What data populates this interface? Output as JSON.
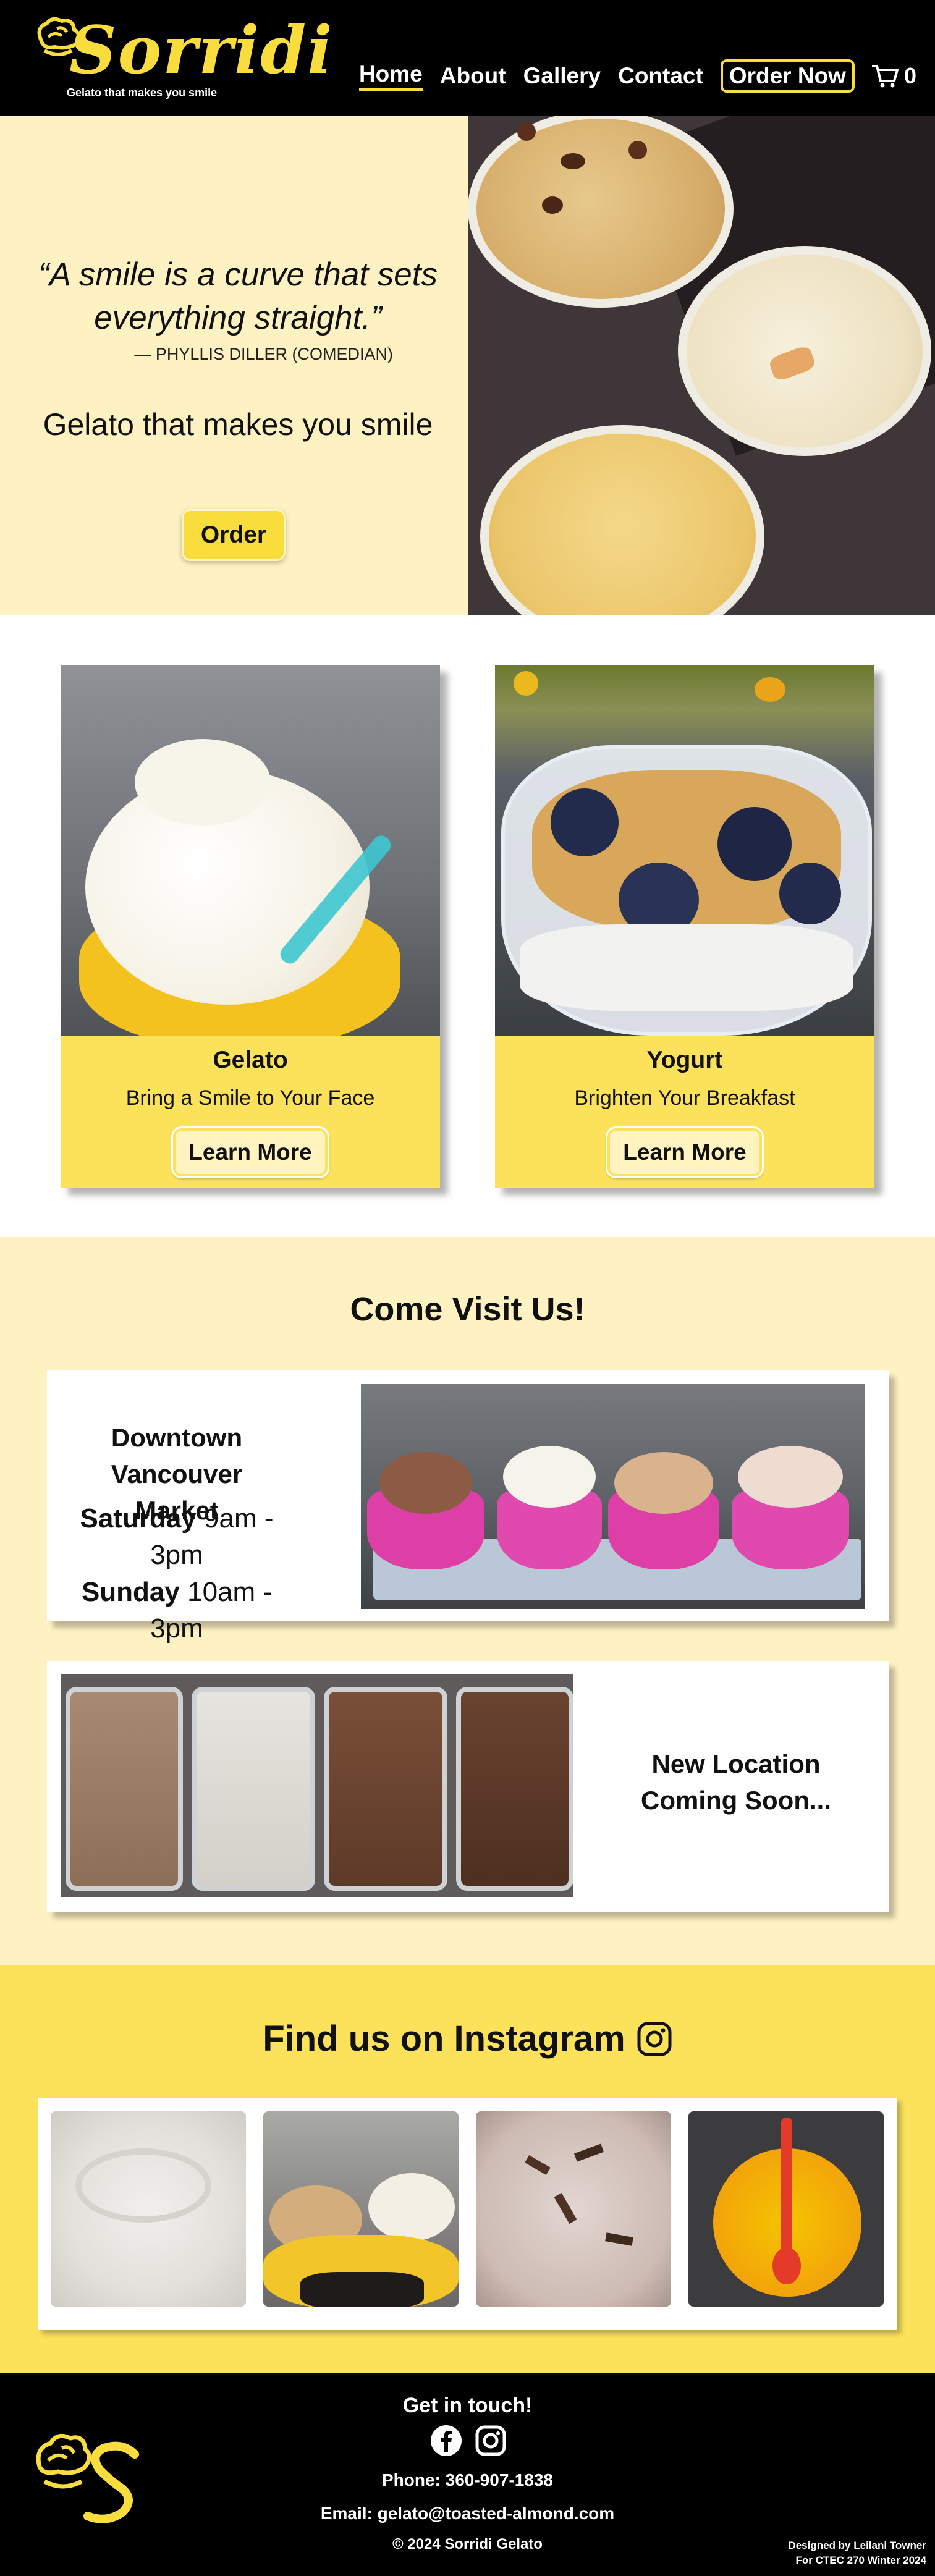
{
  "header": {
    "logo_text": "Sorridi",
    "logo_tagline": "Gelato that makes you smile",
    "nav": [
      "Home",
      "About",
      "Gallery",
      "Contact"
    ],
    "order_label": "Order Now",
    "cart_count": "0"
  },
  "hero": {
    "quote": "“A smile is a curve that sets everything straight.”",
    "quote_author": "— PHYLLIS DILLER (COMEDIAN)",
    "tagline": "Gelato that makes you smile",
    "order_label": "Order"
  },
  "products": [
    {
      "title": "Gelato",
      "subtitle": "Bring a Smile to Your Face",
      "button": "Learn More"
    },
    {
      "title": "Yogurt",
      "subtitle": "Brighten Your Breakfast",
      "button": "Learn More"
    }
  ],
  "visit": {
    "title": "Come Visit Us!",
    "location1": {
      "name_line1": "Downtown",
      "name_line2": "Vancouver Market",
      "day1": "Saturday",
      "hours1": "9am - 3pm",
      "day2": "Sunday",
      "hours2": "10am - 3pm"
    },
    "location2": {
      "name_line1": "New Location",
      "name_line2": "Coming Soon..."
    }
  },
  "instagram": {
    "title": "Find us on Instagram"
  },
  "footer": {
    "title": "Get in touch!",
    "phone": "Phone: 360-907-1838",
    "email": "Email: gelato@toasted-almond.com",
    "copyright": "© 2024 Sorridi Gelato",
    "credit_line1": "Designed by Leilani Towner",
    "credit_line2": "For CTEC 270 Winter 2024"
  },
  "colors": {
    "brand_yellow": "#f9dd3c",
    "cream": "#fef1c2",
    "black": "#000000"
  }
}
